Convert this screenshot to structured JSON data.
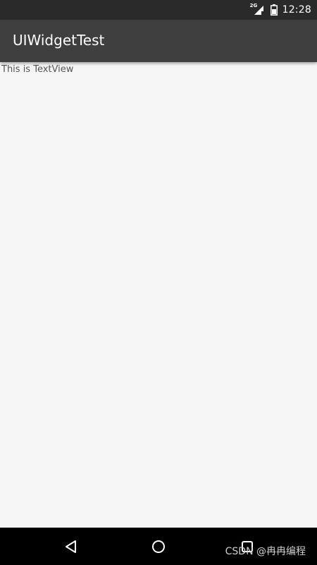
{
  "status_bar": {
    "network_type": "2G",
    "time": "12:28",
    "icons": [
      "signal-icon",
      "battery-icon"
    ]
  },
  "app_bar": {
    "title": "UIWidgetTest"
  },
  "content": {
    "text_view": "This is TextView"
  },
  "nav_bar": {
    "icons": [
      "back-icon",
      "home-icon",
      "recents-icon"
    ],
    "watermark": "CSDN @冉冉编程"
  },
  "colors": {
    "status_bar": "#2a2a2a",
    "app_bar": "#3f3f3f",
    "background": "#f6f6f6",
    "nav_bar": "#000000",
    "text": "#555555"
  }
}
